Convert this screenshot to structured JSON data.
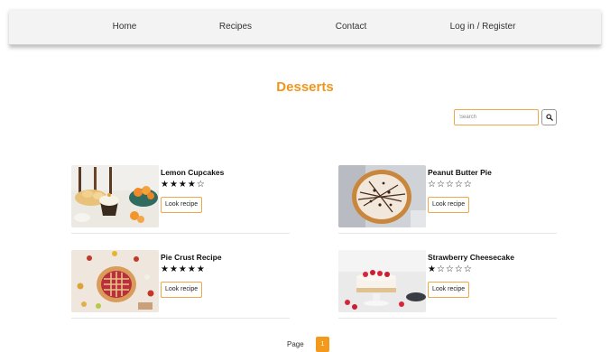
{
  "nav": {
    "items": [
      {
        "label": "Home"
      },
      {
        "label": "Recipes"
      },
      {
        "label": "Contact"
      },
      {
        "label": "Log in / Register"
      }
    ]
  },
  "page": {
    "title": "Desserts",
    "title_color": "#f0961e"
  },
  "search": {
    "placeholder": "Search",
    "value": "",
    "button_icon": "search-icon"
  },
  "recipes": [
    {
      "title": "Lemon Cupcakes",
      "rating": 4,
      "stars": "★★★★☆",
      "button_label": "Look recipe"
    },
    {
      "title": "Peanut Butter Pie",
      "rating": 0,
      "stars": "☆☆☆☆☆",
      "button_label": "Look recipe"
    },
    {
      "title": "Pie Crust Recipe",
      "rating": 5,
      "stars": "★★★★★",
      "button_label": "Look recipe"
    },
    {
      "title": "Strawberry Cheesecake",
      "rating": 1,
      "stars": "★☆☆☆☆",
      "button_label": "Look recipe"
    }
  ],
  "pagination": {
    "label": "Page",
    "current": "1",
    "accent": "#f39a1d"
  }
}
